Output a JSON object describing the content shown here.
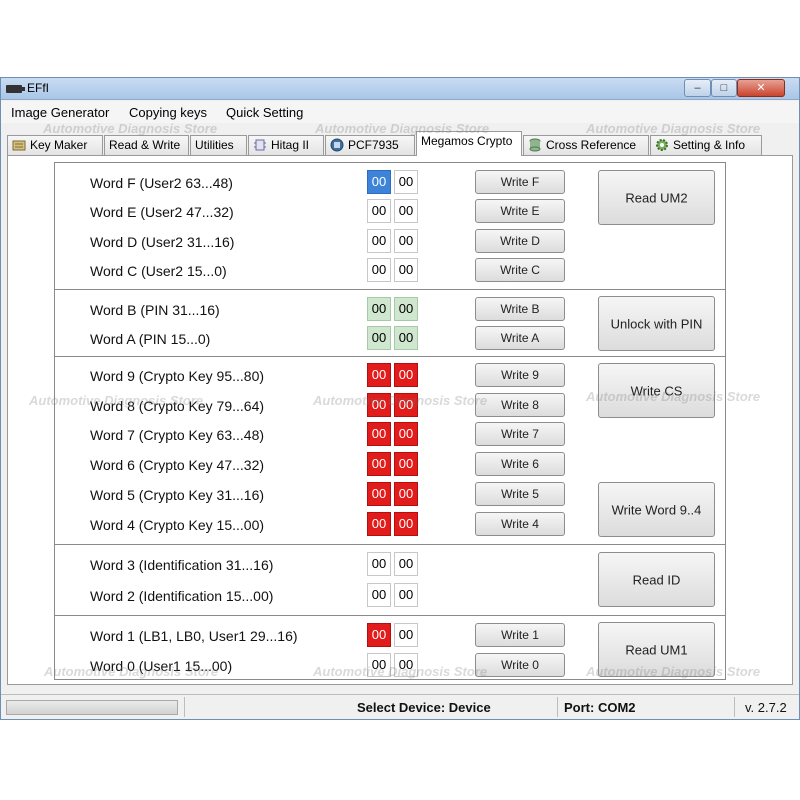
{
  "window": {
    "title": "EFfI"
  },
  "menu": {
    "items": [
      "Image Generator",
      "Copying keys",
      "Quick Setting"
    ]
  },
  "tabs": [
    "Key Maker",
    "Read & Write",
    "Utilities",
    "Hitag II",
    "PCF7935",
    "Megamos Crypto",
    "Cross Reference",
    "Setting & Info"
  ],
  "active_tab": "Megamos Crypto",
  "watermark": "Automotive Diagnosis Store",
  "sections": [
    {
      "rows": [
        {
          "label": "Word F (User2 63...48)",
          "hex": [
            "00",
            "00"
          ],
          "write": "Write F"
        },
        {
          "label": "Word E (User2 47...32)",
          "hex": [
            "00",
            "00"
          ],
          "write": "Write E"
        },
        {
          "label": "Word D (User2 31...16)",
          "hex": [
            "00",
            "00"
          ],
          "write": "Write D"
        },
        {
          "label": "Word C (User2 15...0)",
          "hex": [
            "00",
            "00"
          ],
          "write": "Write C"
        }
      ],
      "button": "Read UM2"
    },
    {
      "rows": [
        {
          "label": "Word B (PIN 31...16)",
          "hex": [
            "00",
            "00"
          ],
          "write": "Write B"
        },
        {
          "label": "Word A (PIN 15...0)",
          "hex": [
            "00",
            "00"
          ],
          "write": "Write A"
        }
      ],
      "button": "Unlock with PIN"
    },
    {
      "rows": [
        {
          "label": "Word 9 (Crypto Key 95...80)",
          "hex": [
            "00",
            "00"
          ],
          "write": "Write 9"
        },
        {
          "label": "Word 8 (Crypto Key 79...64)",
          "hex": [
            "00",
            "00"
          ],
          "write": "Write 8"
        },
        {
          "label": "Word 7 (Crypto Key 63...48)",
          "hex": [
            "00",
            "00"
          ],
          "write": "Write 7"
        },
        {
          "label": "Word 6 (Crypto Key 47...32)",
          "hex": [
            "00",
            "00"
          ],
          "write": "Write 6"
        },
        {
          "label": "Word 5 (Crypto Key 31...16)",
          "hex": [
            "00",
            "00"
          ],
          "write": "Write 5"
        },
        {
          "label": "Word 4 (Crypto Key 15...00)",
          "hex": [
            "00",
            "00"
          ],
          "write": "Write 4"
        }
      ],
      "buttons": [
        "Write CS",
        "Write Word 9..4"
      ]
    },
    {
      "rows": [
        {
          "label": "Word 3 (Identification 31...16)",
          "hex": [
            "00",
            "00"
          ]
        },
        {
          "label": "Word 2 (Identification 15...00)",
          "hex": [
            "00",
            "00"
          ]
        }
      ],
      "button": "Read ID"
    },
    {
      "rows": [
        {
          "label": "Word 1 (LB1, LB0, User1 29...16)",
          "hex": [
            "00",
            "00"
          ],
          "write": "Write 1"
        },
        {
          "label": "Word 0 (User1 15...00)",
          "hex": [
            "00",
            "00"
          ],
          "write": "Write 0"
        }
      ],
      "button": "Read UM1"
    }
  ],
  "status": {
    "device": "Select Device:  Device",
    "port": "Port:  COM2",
    "version": "v. 2.7.2"
  },
  "colors": {
    "crypto_red": "#e21b1b",
    "pin_green": "#cfe6cf",
    "selection_blue": "#3d84d9"
  }
}
